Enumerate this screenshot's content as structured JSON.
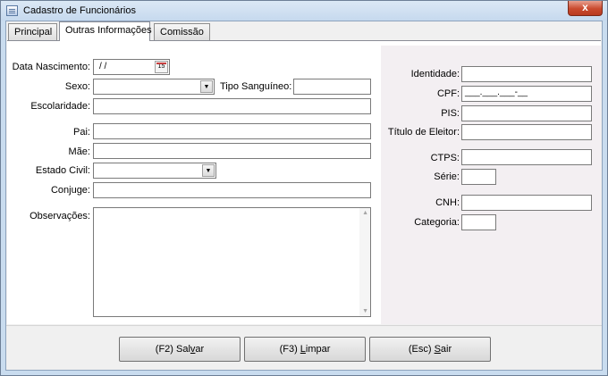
{
  "window": {
    "title": "Cadastro de Funcionários",
    "close_label": "x"
  },
  "tabs": [
    {
      "label": "Principal",
      "active": false
    },
    {
      "label": "Outras Informações",
      "active": true
    },
    {
      "label": "Comissão",
      "active": false
    }
  ],
  "left_form": {
    "data_nascimento": {
      "label": "Data Nascimento:",
      "value": "/ /",
      "calendar_icon_label": "15"
    },
    "sexo": {
      "label": "Sexo:",
      "value": ""
    },
    "tipo_sanguineo": {
      "label": "Tipo Sanguíneo:",
      "value": ""
    },
    "escolaridade": {
      "label": "Escolaridade:",
      "value": ""
    },
    "pai": {
      "label": "Pai:",
      "value": ""
    },
    "mae": {
      "label": "Mãe:",
      "value": ""
    },
    "estado_civil": {
      "label": "Estado Civil:",
      "value": ""
    },
    "conjuge": {
      "label": "Conjuge:",
      "value": ""
    },
    "observacoes": {
      "label": "Observações:",
      "value": ""
    }
  },
  "right_form": {
    "identidade": {
      "label": "Identidade:",
      "value": ""
    },
    "cpf": {
      "label": "CPF:",
      "value": "___.___.___-__"
    },
    "pis": {
      "label": "PIS:",
      "value": ""
    },
    "titulo_eleitor": {
      "label": "Título de Eleitor:",
      "value": ""
    },
    "ctps": {
      "label": "CTPS:",
      "value": ""
    },
    "serie": {
      "label": "Série:",
      "value": ""
    },
    "cnh": {
      "label": "CNH:",
      "value": ""
    },
    "categoria": {
      "label": "Categoria:",
      "value": ""
    }
  },
  "buttons": {
    "salvar": {
      "pre": "(F2) Sal",
      "ul": "v",
      "post": "ar"
    },
    "limpar": {
      "pre": "(F3) ",
      "ul": "L",
      "post": "impar"
    },
    "sair": {
      "pre": "(Esc) ",
      "ul": "S",
      "post": "air"
    }
  },
  "colors": {
    "title_bar": "#c6d9ee",
    "close_button": "#c94a2e",
    "right_panel": "#f3eff2"
  }
}
